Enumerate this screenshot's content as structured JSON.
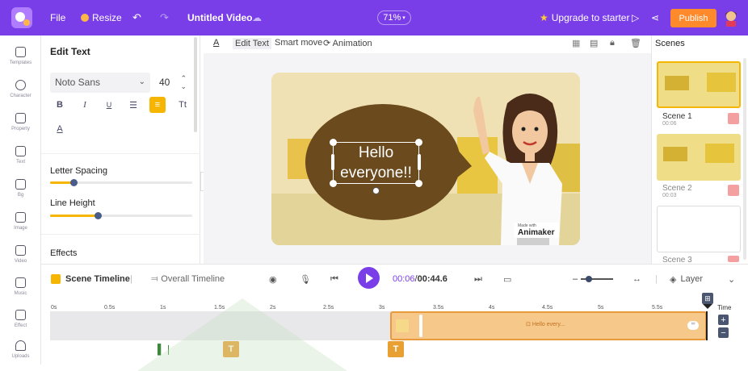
{
  "topbar": {
    "file": "File",
    "resize": "Resize",
    "title": "Untitled Video",
    "zoom": "71%",
    "upgrade": "Upgrade to starter",
    "publish": "Publish"
  },
  "leftnav": [
    "Templates",
    "Character",
    "Property",
    "Text",
    "Bg",
    "Image",
    "Video",
    "Music",
    "Effect",
    "Uploads"
  ],
  "panel": {
    "title": "Edit Text",
    "font": "Noto Sans",
    "size": "40",
    "bold": "B",
    "italic": "I",
    "underline": "U",
    "case": "Tt",
    "color": "A",
    "letter_spacing": "Letter Spacing",
    "line_height": "Line Height",
    "effects": "Effects",
    "letter_spacing_value": 0.17,
    "line_height_value": 0.34
  },
  "toolbar": {
    "edit_text": "Edit Text",
    "smart_move": "Smart move",
    "animation": "Animation",
    "color_a": "A"
  },
  "canvas": {
    "bubble_text_1": "Hello",
    "bubble_text_2": "everyone!!",
    "watermark_small": "Made with",
    "watermark": "Animaker"
  },
  "scenes": {
    "title": "Scenes",
    "items": [
      {
        "name": "Scene 1",
        "duration": "00:06"
      },
      {
        "name": "Scene 2",
        "duration": "00:03"
      },
      {
        "name": "Scene 3",
        "duration": ""
      }
    ]
  },
  "timeline": {
    "scene_timeline": "Scene Timeline",
    "overall_timeline": "Overall Timeline",
    "current": "00:06",
    "separator": " / ",
    "total": "00:44.6",
    "layer": "Layer",
    "time": "Time",
    "ticks": [
      "0s",
      "0.5s",
      "1s",
      "1.5s",
      "2s",
      "2.5s",
      "3s",
      "3.5s",
      "4s",
      "4.5s",
      "5s",
      "5.5s"
    ],
    "clip_label": "Hello every..."
  },
  "colors": {
    "brand": "#7a3ee8",
    "accent": "#f5b500",
    "publish": "#ff8a2b"
  }
}
